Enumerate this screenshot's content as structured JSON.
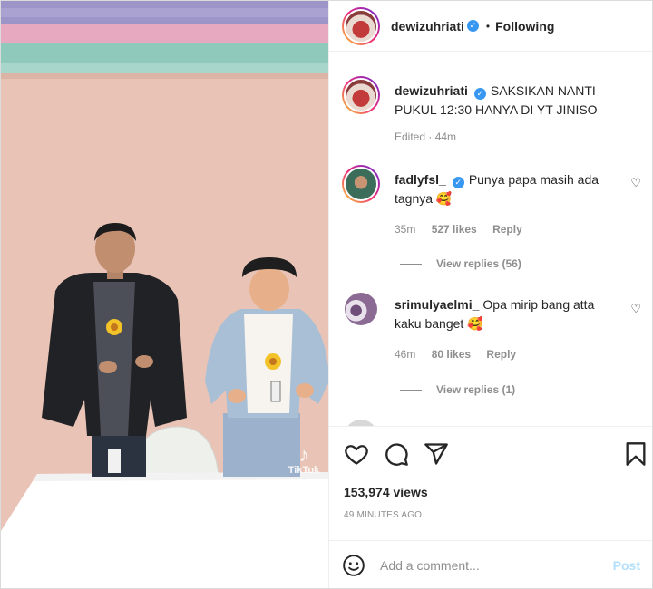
{
  "post": {
    "author": "dewizuhriati",
    "separator": "•",
    "follow_state": "Following",
    "caption": "SAKSIKAN NANTI PUKUL 12:30 HANYA DI YT JINISO",
    "edited": "Edited · 44m",
    "views": "153,974 views",
    "posted_time": "49 MINUTES AGO",
    "watermark": "TikTok"
  },
  "comments": [
    {
      "username": "fadlyfsl_",
      "verified": true,
      "text": "Punya papa masih ada tagnya 🥰",
      "age": "35m",
      "likes": "527 likes",
      "reply_label": "Reply",
      "view_replies": "View replies (56)"
    },
    {
      "username": "srimulyaelmi_",
      "verified": false,
      "text": "Opa mirip bang atta kaku banget 🥰",
      "age": "46m",
      "likes": "80 likes",
      "reply_label": "Reply",
      "view_replies": "View replies (1)"
    }
  ],
  "composer": {
    "placeholder": "Add a comment...",
    "post_label": "Post"
  },
  "icons": {
    "like": "heart-icon",
    "comment": "comment-icon",
    "share": "paper-plane-icon",
    "save": "bookmark-icon",
    "emoji": "smiley-icon",
    "verified": "verified-badge-icon"
  },
  "colors": {
    "verified_blue": "#3897f0",
    "post_disabled": "#b2dffc",
    "muted_text": "#8e8e8e"
  }
}
